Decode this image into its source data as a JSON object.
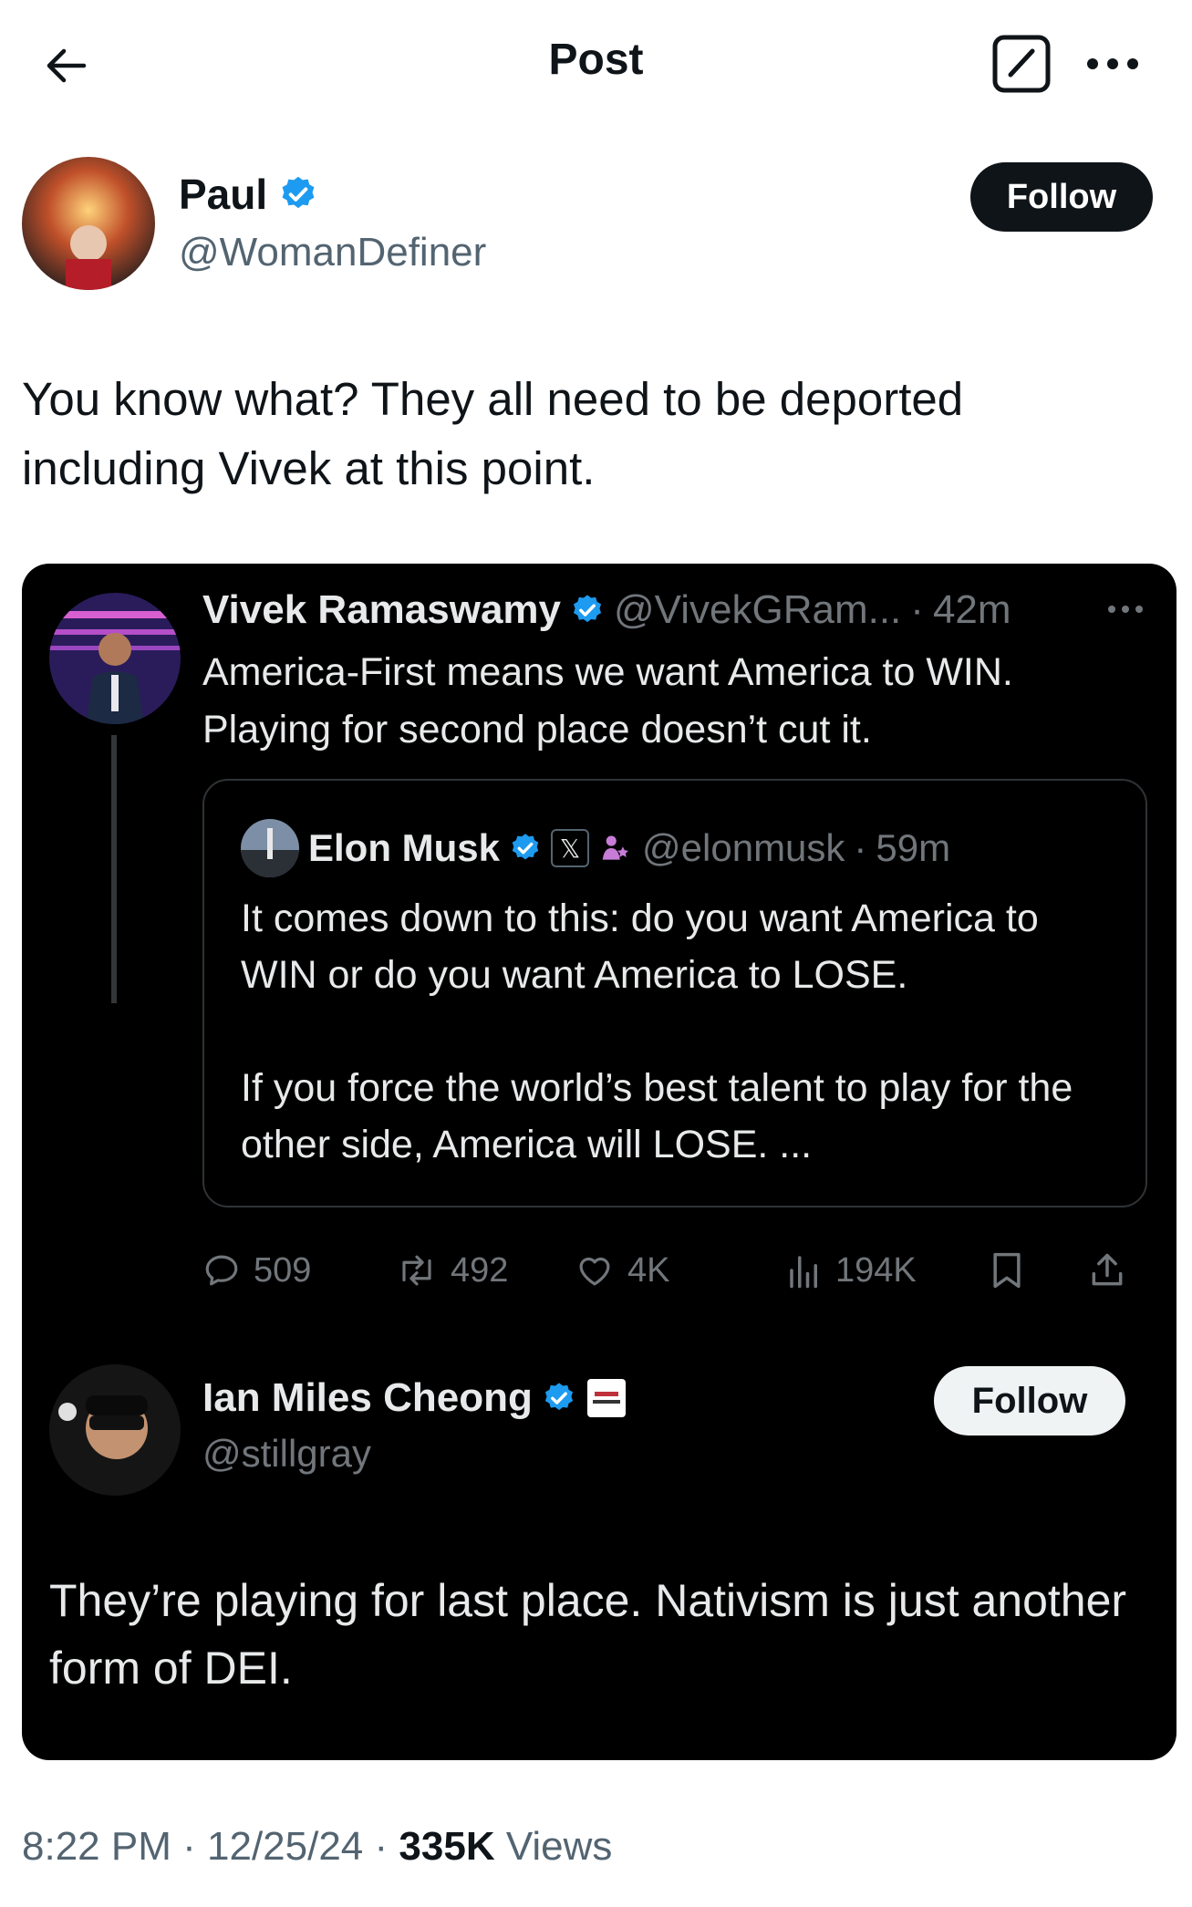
{
  "header": {
    "title": "Post",
    "back_icon": "arrow-left-icon",
    "compose_icon": "compose-icon",
    "more_icon": "more-horizontal-icon"
  },
  "post": {
    "author_name": "Paul",
    "author_handle": "@WomanDefiner",
    "follow_label": "Follow",
    "text": "You know what? They all need to be deported including Vivek at this point.",
    "time": "8:22 PM",
    "date": "12/25/24",
    "views_count": "335K",
    "views_label": "Views",
    "separator": "·"
  },
  "embedded": {
    "vivek": {
      "name": "Vivek Ramaswamy",
      "handle": "@VivekGRam...",
      "separator": "·",
      "time": "42m",
      "text": "America-First means we want America to WIN. Playing for second place doesn’t cut it."
    },
    "quote": {
      "name": "Elon Musk",
      "badge": "𝕏",
      "handle": "@elonmusk",
      "separator": "·",
      "time": "59m",
      "text": "It comes down to this: do you want America to WIN or do you want America to LOSE.\n\nIf you force the world’s best talent to play for the other side, America will LOSE. ..."
    },
    "actions": {
      "replies": "509",
      "reposts": "492",
      "likes": "4K",
      "views": "194K"
    },
    "reply": {
      "name": "Ian Miles Cheong",
      "handle": "@stillgray",
      "follow_label": "Follow",
      "text": "They’re playing for last place. Nativism is just another form of DEI."
    }
  },
  "colors": {
    "verified": "#1d9bf0",
    "card_bg": "#000000",
    "muted": "#71767b",
    "button_dark": "#0f1419"
  }
}
